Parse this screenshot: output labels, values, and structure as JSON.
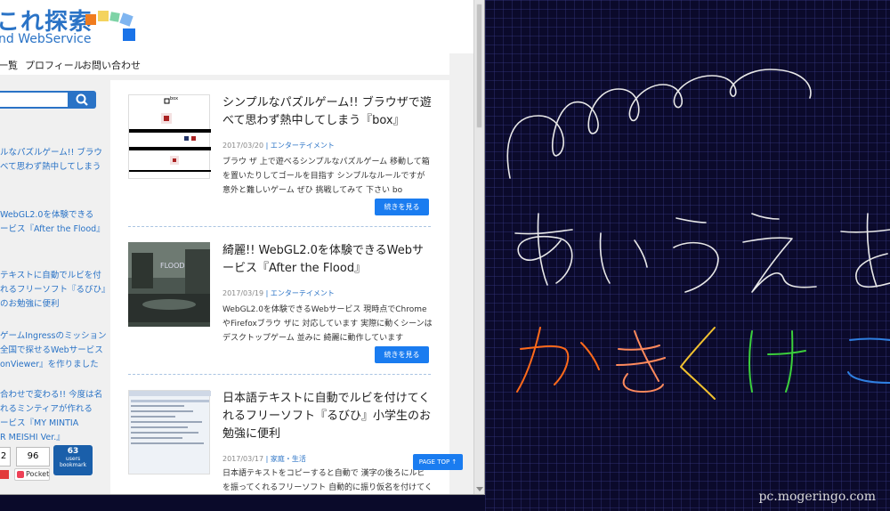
{
  "site": {
    "logo_title": "これ探索",
    "logo_subtitle": "nd WebService"
  },
  "nav": [
    "一覧",
    "プロフィール",
    "お問い合わせ"
  ],
  "sidebar": {
    "links": [
      "ルなパズルゲーム!! ブラウ",
      "べて思わず熱中してしまう",
      "WebGL2.0を体験できる",
      "ービス『After the Flood』",
      "テキストに自動でルビを付",
      "れるフリーソフト『るびひ』",
      "のお勉強に便利",
      "ゲームIngressのミッション",
      "全国で探せるWebサービス",
      "onViewer』を作りました",
      "合わせで変わる!! 今度は名",
      "れるミンティアが作れる",
      "ービス『MY MINTIA",
      "R MEISHI Ver.』"
    ]
  },
  "share": {
    "count_a": "2",
    "count_b": "96",
    "pocket_label": "Pocket",
    "hatena_count": "63",
    "hatena_users": "users",
    "hatena_label": "bookmark"
  },
  "posts": [
    {
      "title": "シンプルなパズルゲーム!! ブラウザで遊べて思わず熱中してしまう『box』",
      "date": "2017/03/20",
      "category": "エンターテイメント",
      "excerpt": "ブラウ ザ 上で遊べるシンプルなパズルゲーム 移動して箱を置いたりしてゴールを目指す シンプルなルールですが 意外と難しいゲーム ぜひ 挑戦してみて 下さい bo",
      "more": "続きを見る",
      "thumb_label": "box"
    },
    {
      "title": "綺麗!! WebGL2.0を体験できるWebサービス『After the Flood』",
      "date": "2017/03/19",
      "category": "エンターテイメント",
      "excerpt": "WebGL2.0を体験できるWebサービス 現時点でChromeやFirefoxブラウ ザに 対応しています 実際に動くシーンはデスクトップゲーム 並みに 綺麗に動作しています",
      "more": "続きを見る",
      "thumb_label": "FLOOD"
    },
    {
      "title": "日本語テキストに自動でルビを付けてくれるフリーソフト『るびひ』小学生のお勉強に便利",
      "date": "2017/03/17",
      "category": "家庭・生活",
      "excerpt": "日本語テキストをコピーすると自動で 漢字の後ろにルビを振ってくれるフリーソフト 自動的に振り仮名を付けてくれるので",
      "more": "続きを見る"
    }
  ],
  "page_top": "PAGE TOP ↑",
  "canvas": {
    "watermark": "pc.mogeringo.com",
    "grid_color": "#2b2b6e",
    "stroke_white": "#e8e8e8",
    "stroke_orange": "#ff6a1a",
    "stroke_peach": "#ff8a5c",
    "stroke_yellow": "#f2c230",
    "stroke_green": "#3ccf3c",
    "stroke_blue": "#2f7fe0"
  }
}
